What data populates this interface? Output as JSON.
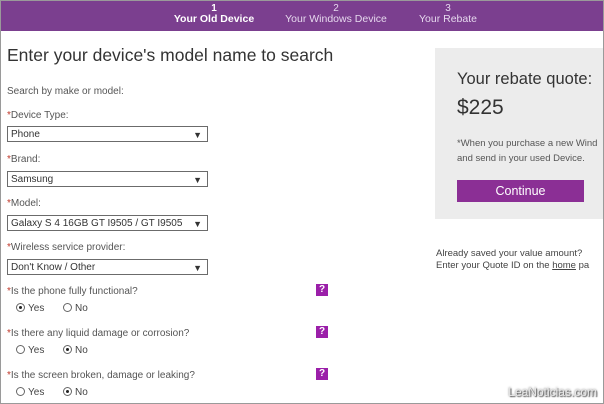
{
  "steps": [
    {
      "num": "1",
      "label": "Your Old Device",
      "active": true
    },
    {
      "num": "2",
      "label": "Your Windows Device",
      "active": false
    },
    {
      "num": "3",
      "label": "Your Rebate",
      "active": false
    }
  ],
  "page_title": "Enter your device's model name to search",
  "subtitle": "Search by make or model:",
  "fields": {
    "device_type": {
      "label": "Device Type:",
      "value": "Phone"
    },
    "brand": {
      "label": "Brand:",
      "value": "Samsung"
    },
    "model": {
      "label": "Model:",
      "value": "Galaxy S 4 16GB GT I9505 / GT I9505"
    },
    "provider": {
      "label": "Wireless service provider:",
      "value": "Don't Know / Other"
    }
  },
  "required_marker": "*",
  "questions": [
    {
      "text": "Is the phone fully functional?",
      "selected": "Yes"
    },
    {
      "text": "Is there any liquid damage or corrosion?",
      "selected": "No"
    },
    {
      "text": "Is the screen broken, damage or leaking?",
      "selected": "No"
    }
  ],
  "yes_label": "Yes",
  "no_label": "No",
  "help_label": "?",
  "rebate": {
    "title": "Your rebate quote:",
    "amount": "$225",
    "note_line1": "*When you purchase a new Wind",
    "note_line2": "and send in your used Device.",
    "continue_label": "Continue"
  },
  "saved": {
    "line1": "Already saved your value amount?",
    "line2_prefix": "Enter your Quote ID on the ",
    "link": "home",
    "line2_suffix": " pa"
  },
  "watermark": "LeaNoticias.com",
  "colors": {
    "brand": "#7b3f8f",
    "button": "#8b2f95",
    "help": "#9b1fa9"
  }
}
